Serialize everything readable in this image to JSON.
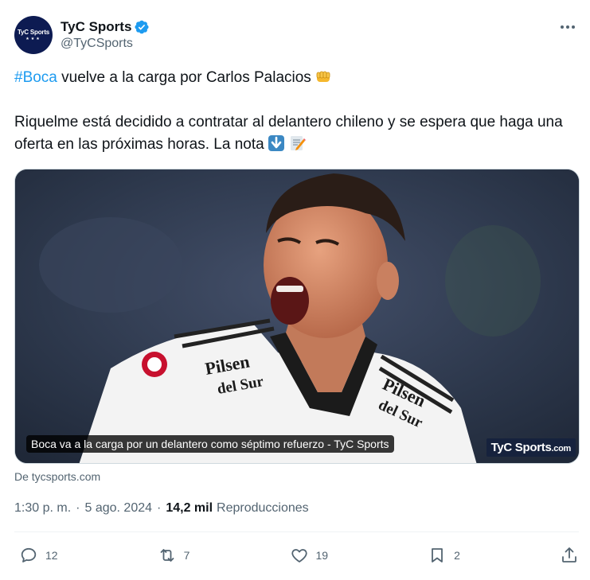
{
  "account": {
    "display_name": "TyC Sports",
    "handle": "@TyCSports",
    "avatar_text": "TyC Sports",
    "avatar_stars": "★★★",
    "verified": true
  },
  "tweet": {
    "hashtag": "#Boca",
    "line1_rest": " vuelve a la carga por Carlos Palacios",
    "line1_emoji": "oncoming-fist-emoji",
    "line2": "Riquelme está decidido a contratar al delantero chileno y se espera que haga una oferta en las próximas horas. La nota",
    "line2_emojis": [
      "down-arrow-emoji",
      "memo-emoji"
    ]
  },
  "media": {
    "caption": "Boca va a la carga por un delantero como séptimo refuerzo - TyC Sports",
    "badge_main": "TyC Sports",
    "badge_suffix": ".com",
    "shirt_sponsor_line1": "Pilsen",
    "shirt_sponsor_line2": "del Sur"
  },
  "source": {
    "text": "De tycsports.com"
  },
  "meta": {
    "time": "1:30 p. m.",
    "separator": "·",
    "date": "5 ago. 2024",
    "separator2": "·",
    "views_count": "14,2 mil",
    "views_label": "Reproducciones"
  },
  "actions": {
    "replies": "12",
    "retweets": "7",
    "likes": "19",
    "bookmarks": "2"
  },
  "colors": {
    "accent": "#1d9bf0",
    "text": "#0f1419",
    "secondary": "#536471",
    "avatar_bg": "#0d1b52"
  }
}
